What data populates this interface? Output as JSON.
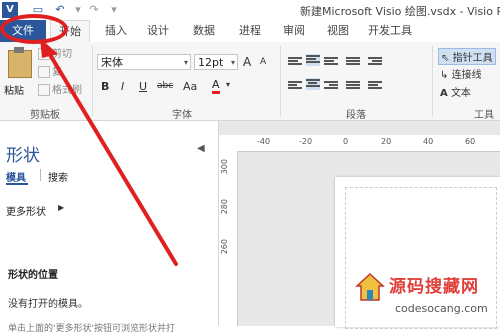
{
  "titlebar": {
    "app_icon": "V",
    "window_title": "新建Microsoft Visio 绘图.vsdx - Visio Pro",
    "quick_access": [
      "save-icon",
      "undo-icon",
      "redo-icon",
      "customize-icon"
    ]
  },
  "tabs": [
    {
      "label": "文件"
    },
    {
      "label": "开始"
    },
    {
      "label": "插入"
    },
    {
      "label": "设计"
    },
    {
      "label": "数据"
    },
    {
      "label": "进程"
    },
    {
      "label": "审阅"
    },
    {
      "label": "视图"
    },
    {
      "label": "开发工具"
    }
  ],
  "ribbon": {
    "clipboard": {
      "paste": "粘贴",
      "cut": "剪切",
      "copy": "复",
      "format_painter": "格式刷",
      "group_label": "剪贴板"
    },
    "font": {
      "font_name": "宋体",
      "font_size": "12pt",
      "grow": "A",
      "shrink": "A",
      "bold": "B",
      "italic": "I",
      "underline": "U",
      "strike": "abc",
      "case": "Aa",
      "font_color": "A",
      "group_label": "字体"
    },
    "paragraph": {
      "group_label": "段落"
    },
    "tools": {
      "pointer": "指针工具",
      "connector": "连接线",
      "text": "文本",
      "group_label": "工具"
    }
  },
  "shapes_pane": {
    "title": "形状",
    "tab_stencils": "模具",
    "tab_search": "搜索",
    "more_shapes": "更多形状",
    "section_title": "形状的位置",
    "no_stencils": "没有打开的模具。",
    "hint_partial": "单击上面的'更多形状'按钮可浏览形状并打"
  },
  "rulers": {
    "top_ticks": [
      "-40",
      "-20",
      "0",
      "20",
      "40",
      "60"
    ],
    "left_ticks": [
      "300",
      "280",
      "260"
    ]
  },
  "watermark": {
    "title": "源码搜藏网",
    "url": "codesocang.com"
  },
  "colors": {
    "file_tab": "#2b579a",
    "accent_blue": "#2b579a",
    "annotation_red": "#e02020",
    "ribbon_bg": "#f6f6f6"
  }
}
